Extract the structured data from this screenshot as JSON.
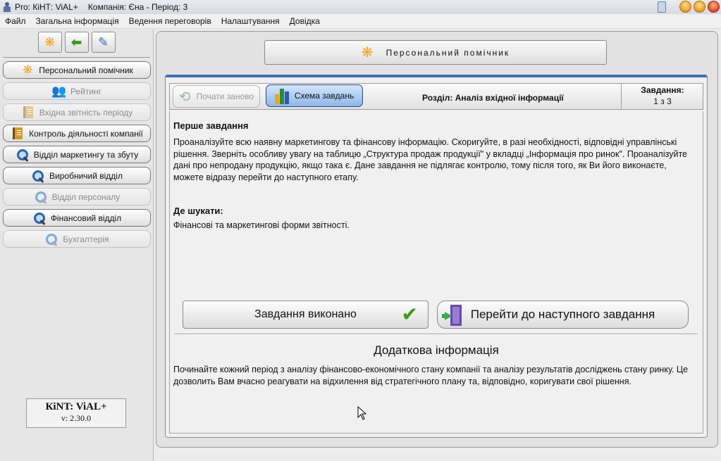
{
  "window": {
    "title": "Pro: КіНТ: ViAL+",
    "company": "Компанія: Єна - Період: 3"
  },
  "menu": [
    "Файл",
    "Загальна інформація",
    "Ведення переговорів",
    "Налаштування",
    "Довідка"
  ],
  "sidebar": {
    "toolbar_icons": [
      "assistant-icon",
      "back-arrow-icon",
      "tools-icon"
    ],
    "items": [
      {
        "label": "Персональний помічник",
        "enabled": true,
        "icon": "assistant-icon"
      },
      {
        "label": "Рейтинг",
        "enabled": false,
        "icon": "people-icon"
      },
      {
        "label": "Вхідна звітність періоду",
        "enabled": false,
        "icon": "report-book-icon"
      },
      {
        "label": "Контроль діяльності компанії",
        "enabled": true,
        "icon": "report-book-icon"
      },
      {
        "label": "Відділ маркетингу та збуту",
        "enabled": true,
        "icon": "magnifier-icon"
      },
      {
        "label": "Виробничий відділ",
        "enabled": true,
        "icon": "magnifier-icon"
      },
      {
        "label": "Відділ персоналу",
        "enabled": false,
        "icon": "magnifier-icon"
      },
      {
        "label": "Фінансовий відділ",
        "enabled": true,
        "icon": "magnifier-icon"
      },
      {
        "label": "Бухгалтерія",
        "enabled": false,
        "icon": "magnifier-icon"
      }
    ],
    "version_name": "КіNT: ViAL+",
    "version_number": "v: 2.30.0"
  },
  "main": {
    "assistant_button": "Персональний помічник",
    "header": {
      "restart_label": "Почати заново",
      "scheme_label": "Схема завдань",
      "section_label": "Розділ: Аналіз вхідної інформації",
      "tasks_label": "Завдання:",
      "tasks_count": "1 з 3"
    },
    "task_title": "Перше завдання",
    "task_text": "Проаналізуйте всю наявну маркетингову та фінансову інформацію. Скоригуйте, в разі необхідності, відповідні управлінські рішення. Зверніть особливу увагу на таблицю „Структура продаж продукції\" у вкладці „Інформація про ринок\". Проаналізуйте дані про непродану продукцію, якщо така є. Дане завдання не підлягає контролю, тому після того, як Ви його виконаєте, можете відразу перейти до наступного етапу.",
    "where_title": "Де шукати:",
    "where_text": "Фінансові та маркетингові форми звітності.",
    "done_button": "Завдання виконано",
    "next_button": "Перейти до наступного завдання",
    "extra_title": "Додаткова інформація",
    "extra_text": "Починайте кожний період з аналізу фінансово-економічного стану компанії та аналізу результатів досліджень стану ринку. Це дозволить Вам вчасно реагувати на відхилення від стратегічного плану та, відповідно, коригувати свої рішення."
  },
  "colors": {
    "accent_blue": "#3e6fb8",
    "check_green": "#3c9a12",
    "assistant_orange": "#f5a623"
  }
}
